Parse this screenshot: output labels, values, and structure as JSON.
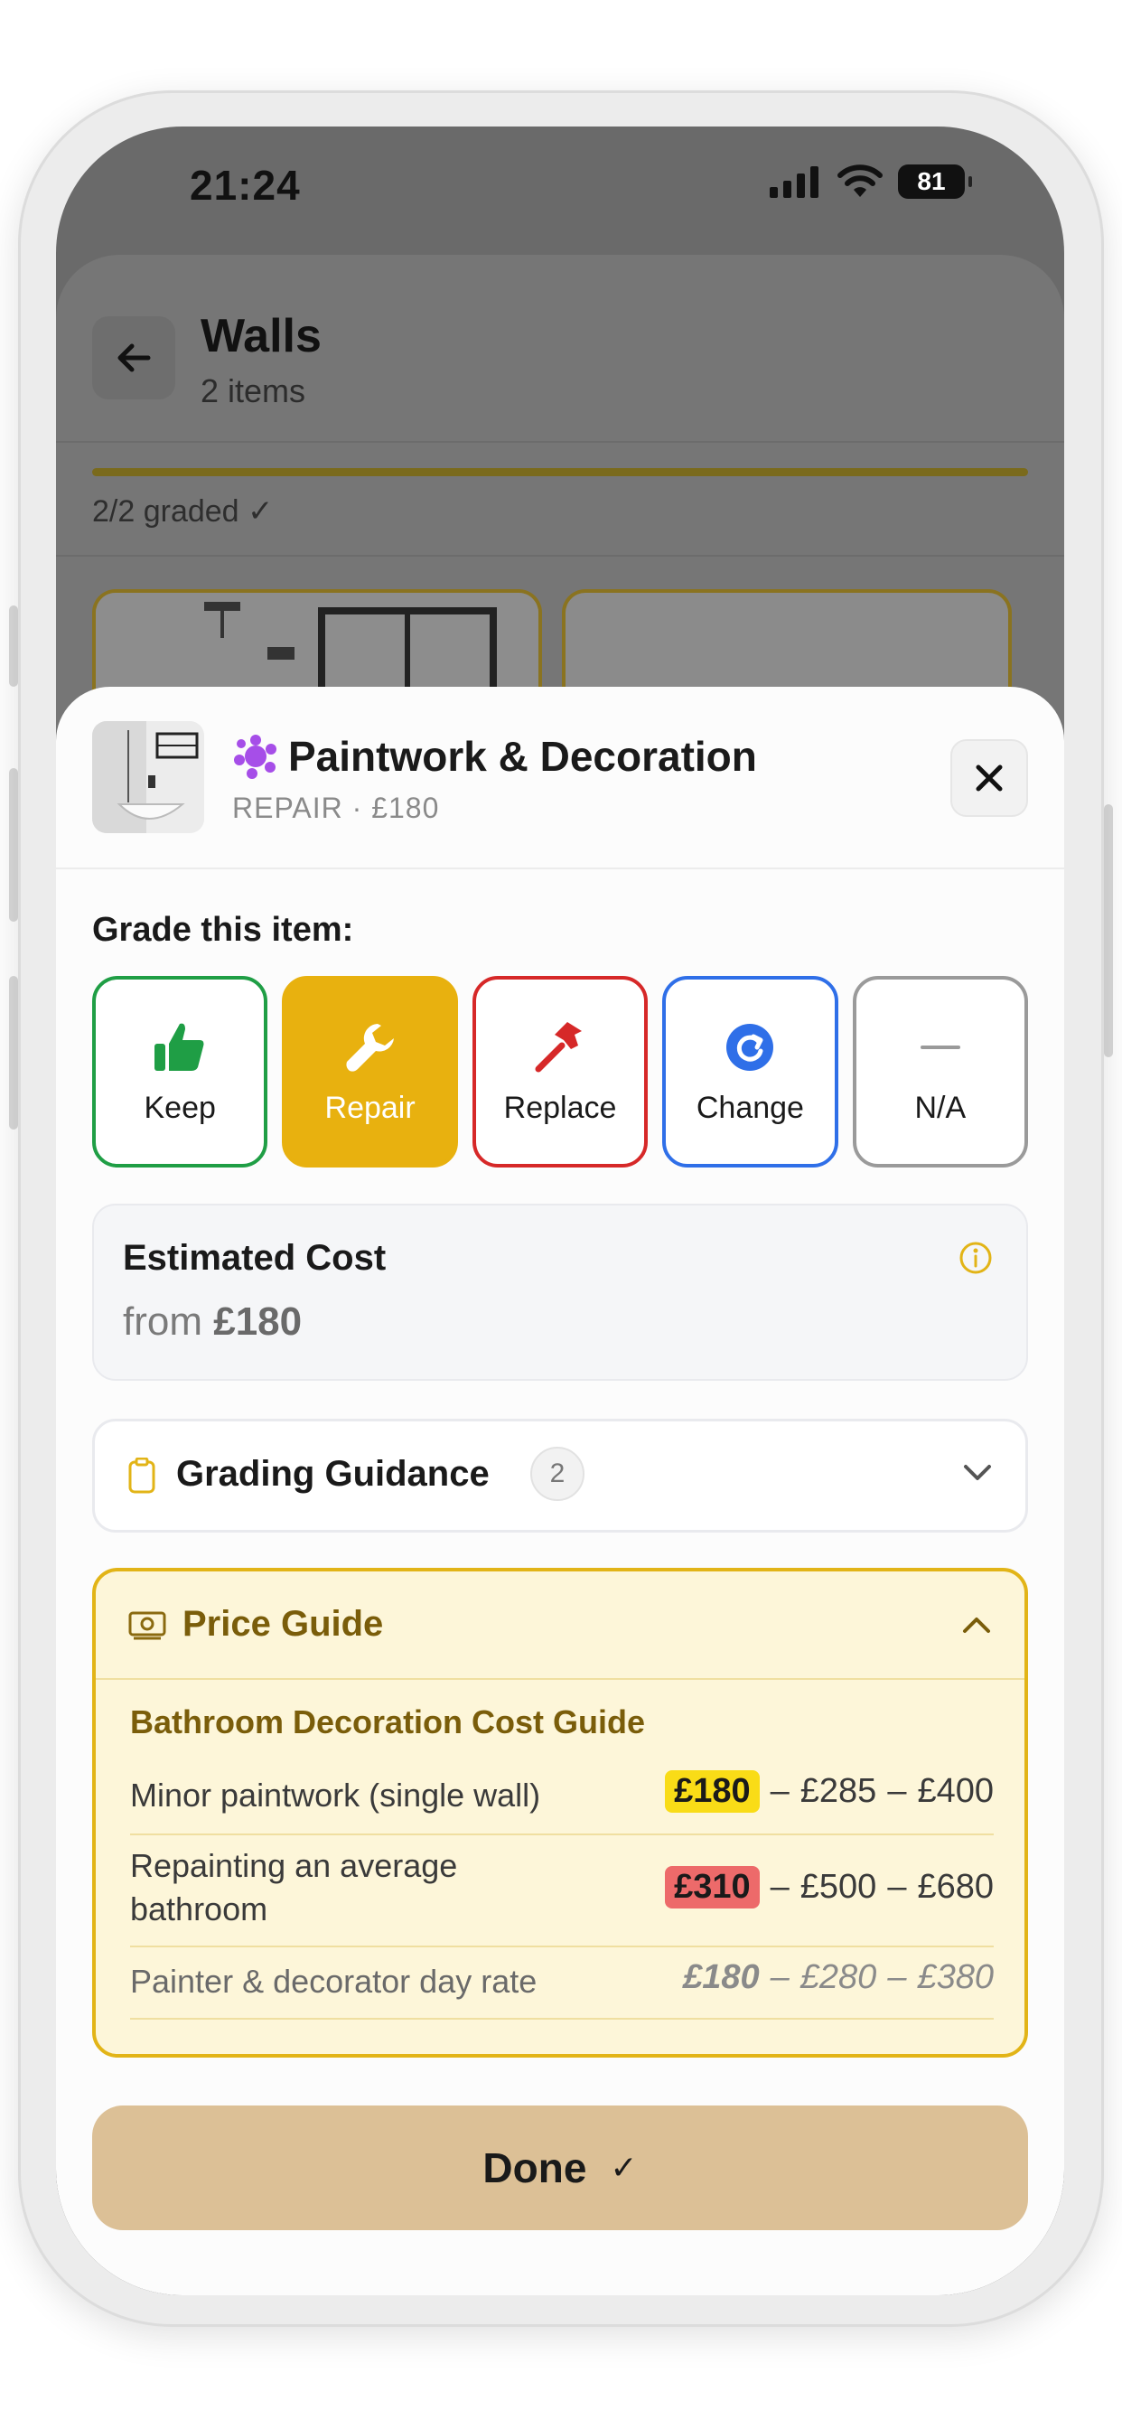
{
  "status_bar": {
    "time": "21:24",
    "battery": "81"
  },
  "background_screen": {
    "title": "Walls",
    "subtitle": "2 items",
    "graded": "2/2 graded ✓"
  },
  "modal": {
    "title": "Paintwork & Decoration",
    "subtitle": "REPAIR · £180",
    "grade_label": "Grade this item:",
    "grade_options": [
      {
        "label": "Keep",
        "icon": "thumbs-up-icon",
        "color": "#1f9e45",
        "selected": false
      },
      {
        "label": "Repair",
        "icon": "wrench-icon",
        "color": "#e8b10f",
        "selected": true
      },
      {
        "label": "Replace",
        "icon": "hammer-icon",
        "color": "#d62828",
        "selected": false
      },
      {
        "label": "Change",
        "icon": "refresh-icon",
        "color": "#2f6fe8",
        "selected": false
      },
      {
        "label": "N/A",
        "icon": "dash-icon",
        "color": "#9a9a9a",
        "selected": false
      }
    ],
    "estimated_cost": {
      "title": "Estimated Cost",
      "prefix": "from",
      "value": "£180"
    },
    "grading_guidance": {
      "title": "Grading Guidance",
      "count": "2"
    },
    "price_guide": {
      "title": "Price Guide",
      "subtitle": "Bathroom Decoration Cost Guide",
      "rows": [
        {
          "label": "Minor paintwork (single wall)",
          "low": "£180",
          "mid": "£285",
          "high": "£400"
        },
        {
          "label": "Repainting an average bathroom",
          "low": "£310",
          "mid": "£500",
          "high": "£680"
        },
        {
          "label": "Painter & decorator day rate",
          "low": "£180",
          "mid": "£280",
          "high": "£380"
        }
      ]
    },
    "done_label": "Done",
    "done_check": "✓"
  },
  "colors": {
    "accent_yellow": "#e8b10f",
    "price_guide_bg": "#fdf6d9",
    "done_bg": "#dcc096"
  }
}
